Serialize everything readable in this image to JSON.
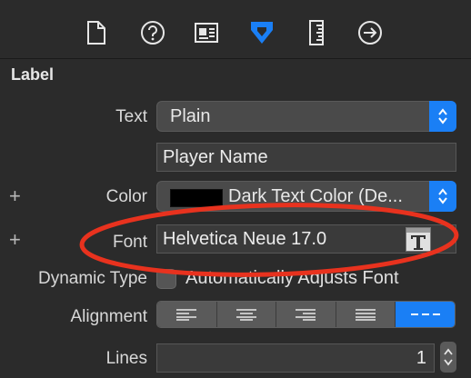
{
  "section": {
    "title": "Label"
  },
  "rows": {
    "text": {
      "label": "Text",
      "value": "Plain"
    },
    "text_field": {
      "value": "Player Name"
    },
    "color": {
      "label": "Color",
      "value": "Dark Text Color (De..."
    },
    "font": {
      "label": "Font",
      "value": "Helvetica Neue 17.0"
    },
    "dynamic_type": {
      "label": "Dynamic Type",
      "checkbox_label": "Automatically Adjusts Font"
    },
    "alignment": {
      "label": "Alignment"
    },
    "lines": {
      "label": "Lines",
      "value": "1"
    }
  },
  "toolbar_icons": [
    "file-icon",
    "help-icon",
    "identity-icon",
    "attributes-icon",
    "size-ruler-icon",
    "connections-icon"
  ],
  "colors": {
    "accent": "#1a7ff5",
    "annotation": "#e8321e",
    "background": "#2b2b2b"
  }
}
